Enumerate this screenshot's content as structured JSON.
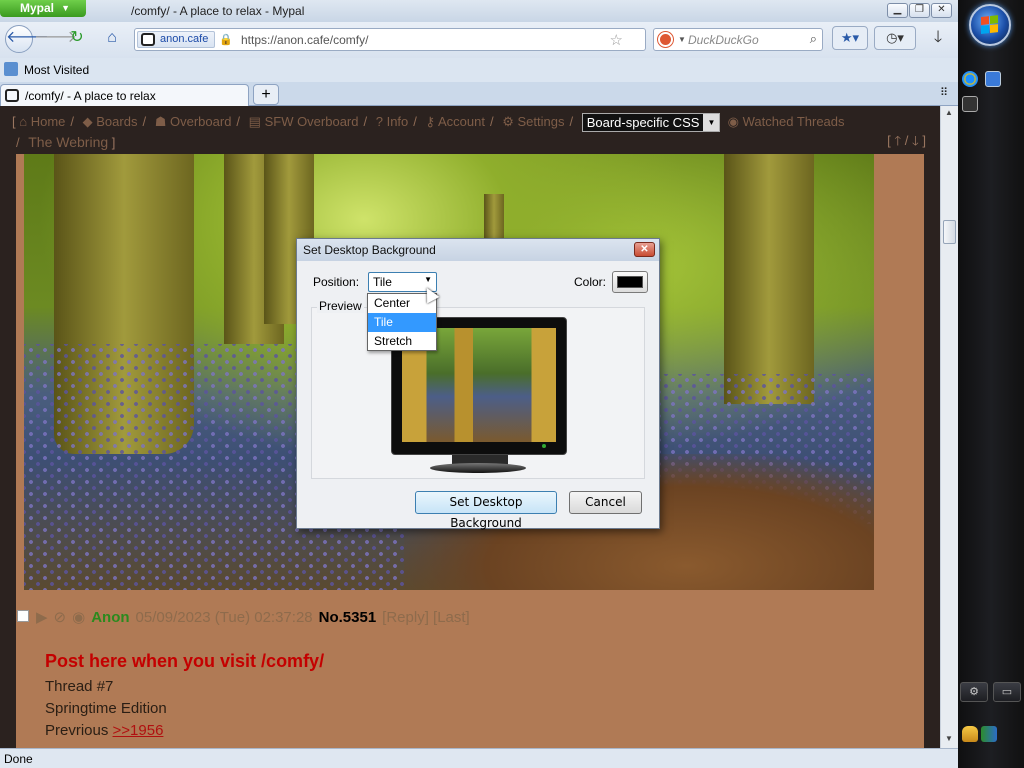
{
  "window": {
    "app_button": "Mypal",
    "title": "/comfy/ - A place to relax - Mypal"
  },
  "navbar": {
    "identity": "anon.cafe",
    "url": "https://anon.cafe/comfy/",
    "search_placeholder": "DuckDuckGo"
  },
  "bookmarks": {
    "most_visited": "Most Visited"
  },
  "tabs": [
    {
      "label": "/comfy/ - A place to relax"
    }
  ],
  "board_nav": {
    "links": [
      "Home",
      "Boards",
      "Overboard",
      "SFW Overboard",
      "Info",
      "Account",
      "Settings"
    ],
    "css_select": "Board-specific CSS",
    "watched": "Watched Threads",
    "webring": "The Webring"
  },
  "post": {
    "name": "Anon",
    "date": "05/09/2023 (Tue) 02:37:28",
    "number": "No.5351",
    "reply": "[Reply]",
    "last": "[Last]",
    "title": "Post here when you visit /comfy/",
    "lines": [
      "Thread #7",
      "Springtime Edition"
    ],
    "previous_label": "Prevrious",
    "previous_link": ">>1956"
  },
  "dialog": {
    "title": "Set Desktop Background",
    "position_label": "Position:",
    "position_value": "Tile",
    "color_label": "Color:",
    "preview_label": "Preview",
    "options": [
      "Center",
      "Tile",
      "Stretch"
    ],
    "selected_option": "Tile",
    "set_button": "Set Desktop Background",
    "cancel_button": "Cancel"
  },
  "status": {
    "text": "Done"
  },
  "colors": {
    "page_background": "#2b221f",
    "post_background": "#b07a55",
    "post_title": "#c40000",
    "name": "#2b8a1e",
    "selection": "#3399ff"
  }
}
